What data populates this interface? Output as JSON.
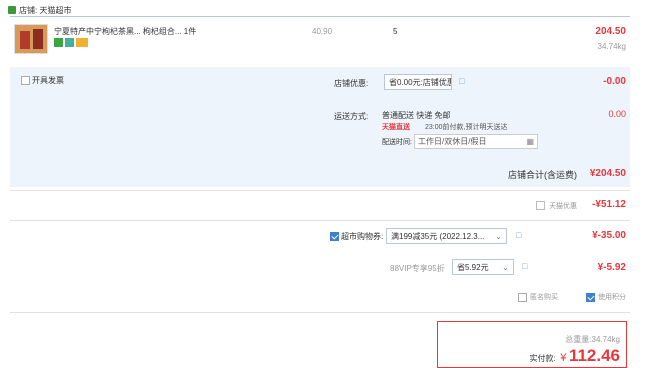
{
  "store": {
    "label": "店铺: 天猫超市",
    "icon": "store-icon"
  },
  "item": {
    "title": "宁夏特产中宁枸杞茶黑... 枸杞组合... 1件",
    "price": "40.90",
    "quantity": "5",
    "subtotal": "204.50",
    "weight": "34.74kg"
  },
  "invoice": {
    "label": "开具发票"
  },
  "store_discount": {
    "label": "店铺优惠:",
    "value": "省0.00元:店铺优惠",
    "amount": "-0.00"
  },
  "shipping": {
    "label": "运送方式:",
    "method": "普通配送 快递 免邮",
    "badge": "天猫直送",
    "note": "23:00前付款,预计明天送达",
    "amount": "0.00",
    "time_label": "配送时间:",
    "time_value": "工作日/双休日/假日"
  },
  "store_total": {
    "label": "店铺合计(含运费)",
    "amount": "¥204.50"
  },
  "discount_row": {
    "label": "天猫优惠",
    "amount": "-¥51.12"
  },
  "coupon": {
    "label": "超市购物券:",
    "value": "满199减35元 (2022.12.3...",
    "amount": "¥-35.00"
  },
  "member": {
    "label": "88VIP专享95折",
    "value": "省5.92元",
    "amount": "¥-5.92"
  },
  "options": {
    "anonymous": "匿名购买",
    "points": "使用积分"
  },
  "summary": {
    "weight_label": "总重量:",
    "weight_value": "34.74kg",
    "pay_label": "实付款:",
    "currency": "¥",
    "pay_amount": "112.46"
  },
  "colors": {
    "accent": "#e4393c",
    "band": "#eef4fb",
    "link": "#3f7fd0"
  }
}
